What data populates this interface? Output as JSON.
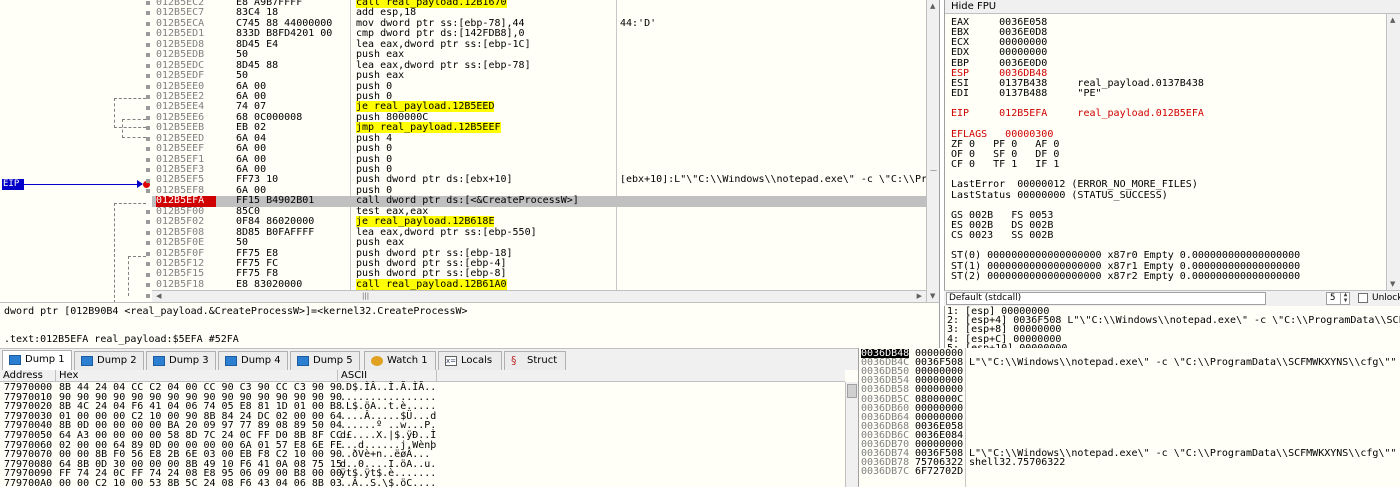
{
  "disasm": {
    "eip_label": "EIP",
    "rows": [
      {
        "addr": "012B5EC2",
        "bytes": "E8 A9B7FFFF",
        "ins": "call real_payload.12B1670",
        "cmt": "",
        "hl": "y"
      },
      {
        "addr": "012B5EC7",
        "bytes": "83C4 18",
        "ins": "add esp,18",
        "cmt": ""
      },
      {
        "addr": "012B5ECA",
        "bytes": "C745 88 44000000",
        "ins": "mov dword ptr ss:[ebp-78],44",
        "cmt": "44:'D'"
      },
      {
        "addr": "012B5ED1",
        "bytes": "833D B8FD4201 00",
        "ins": "cmp dword ptr ds:[142FDB8],0",
        "cmt": ""
      },
      {
        "addr": "012B5ED8",
        "bytes": "8D45 E4",
        "ins": "lea eax,dword ptr ss:[ebp-1C]",
        "cmt": ""
      },
      {
        "addr": "012B5EDB",
        "bytes": "50",
        "ins": "push eax",
        "cmt": ""
      },
      {
        "addr": "012B5EDC",
        "bytes": "8D45 88",
        "ins": "lea eax,dword ptr ss:[ebp-78]",
        "cmt": ""
      },
      {
        "addr": "012B5EDF",
        "bytes": "50",
        "ins": "push eax",
        "cmt": ""
      },
      {
        "addr": "012B5EE0",
        "bytes": "6A 00",
        "ins": "push 0",
        "cmt": ""
      },
      {
        "addr": "012B5EE2",
        "bytes": "6A 00",
        "ins": "push 0",
        "cmt": ""
      },
      {
        "addr": "012B5EE4",
        "bytes": "74 07",
        "ins": "je real_payload.12B5EED",
        "cmt": "",
        "hl": "y"
      },
      {
        "addr": "012B5EE6",
        "bytes": "68 0C000008",
        "ins": "push 800000C",
        "cmt": ""
      },
      {
        "addr": "012B5EEB",
        "bytes": "EB 02",
        "ins": "jmp real_payload.12B5EEF",
        "cmt": "",
        "hl": "y"
      },
      {
        "addr": "012B5EED",
        "bytes": "6A 04",
        "ins": "push 4",
        "cmt": ""
      },
      {
        "addr": "012B5EEF",
        "bytes": "6A 00",
        "ins": "push 0",
        "cmt": ""
      },
      {
        "addr": "012B5EF1",
        "bytes": "6A 00",
        "ins": "push 0",
        "cmt": ""
      },
      {
        "addr": "012B5EF3",
        "bytes": "6A 00",
        "ins": "push 0",
        "cmt": ""
      },
      {
        "addr": "012B5EF5",
        "bytes": "FF73 10",
        "ins": "push dword ptr ds:[ebx+10]",
        "cmt": "[ebx+10]:L\"\\\"C:\\\\Windows\\\\notepad.exe\\\" -c \\\"C:\\\\Prog"
      },
      {
        "addr": "012B5EF8",
        "bytes": "6A 00",
        "ins": "push 0",
        "cmt": ""
      },
      {
        "addr": "012B5EFA",
        "bytes": "FF15 B4902B01",
        "ins": "call dword ptr ds:[<&CreateProcessW>]",
        "cmt": "",
        "cur": true
      },
      {
        "addr": "012B5F00",
        "bytes": "85C0",
        "ins": "test eax,eax",
        "cmt": ""
      },
      {
        "addr": "012B5F02",
        "bytes": "0F84 86020000",
        "ins": "je real_payload.12B618E",
        "cmt": "",
        "hl": "y"
      },
      {
        "addr": "012B5F08",
        "bytes": "8D85 B0FAFFFF",
        "ins": "lea eax,dword ptr ss:[ebp-550]",
        "cmt": ""
      },
      {
        "addr": "012B5F0E",
        "bytes": "50",
        "ins": "push eax",
        "cmt": ""
      },
      {
        "addr": "012B5F0F",
        "bytes": "FF75 E8",
        "ins": "push dword ptr ss:[ebp-18]",
        "cmt": ""
      },
      {
        "addr": "012B5F12",
        "bytes": "FF75 FC",
        "ins": "push dword ptr ss:[ebp-4]",
        "cmt": ""
      },
      {
        "addr": "012B5F15",
        "bytes": "FF75 F8",
        "ins": "push dword ptr ss:[ebp-8]",
        "cmt": ""
      },
      {
        "addr": "012B5F18",
        "bytes": "E8 83020000",
        "ins": "call real_payload.12B61A0",
        "cmt": "",
        "hl": "y"
      },
      {
        "addr": "012B5F1D",
        "bytes": "83C4 10",
        "ins": "add esp,10",
        "cmt": ""
      },
      {
        "addr": "012B5F20",
        "bytes": "85C0",
        "ins": "test eax,eax",
        "cmt": ""
      }
    ]
  },
  "info": {
    "line1": "dword ptr [012B90B4 <real_payload.&CreateProcessW>]=<kernel32.CreateProcessW>",
    "line2": ".text:012B5EFA real_payload:$5EFA #52FA"
  },
  "regs": {
    "title": "Hide FPU",
    "lines": [
      {
        "t": "EAX     0036E058"
      },
      {
        "t": "EBX     0036E0D8"
      },
      {
        "t": "ECX     00000000"
      },
      {
        "t": "EDX     00000000"
      },
      {
        "t": "EBP     0036E0D0"
      },
      {
        "t": "ESP     0036DB48",
        "red": true
      },
      {
        "t": "ESI     0137B438     real_payload.0137B438"
      },
      {
        "t": "EDI     0137B488     \"PE\""
      },
      {
        "t": ""
      },
      {
        "t": "EIP     012B5EFA     real_payload.012B5EFA",
        "red": true
      },
      {
        "t": ""
      },
      {
        "t": "EFLAGS   00000300",
        "red": true
      },
      {
        "t": "ZF 0   PF 0   AF 0"
      },
      {
        "t": "OF 0   SF 0   DF 0"
      },
      {
        "t": "CF 0   TF 1   IF 1"
      },
      {
        "t": ""
      },
      {
        "t": "LastError  00000012 (ERROR_NO_MORE_FILES)"
      },
      {
        "t": "LastStatus 00000000 (STATUS_SUCCESS)"
      },
      {
        "t": ""
      },
      {
        "t": "GS 002B   FS 0053"
      },
      {
        "t": "ES 002B   DS 002B"
      },
      {
        "t": "CS 0023   SS 002B"
      },
      {
        "t": ""
      },
      {
        "t": "ST(0) 0000000000000000000 x87r0 Empty 0.000000000000000000"
      },
      {
        "t": "ST(1) 0000000000000000000 x87r1 Empty 0.000000000000000000"
      },
      {
        "t": "ST(2) 0000000000000000000 x87r2 Empty 0.000000000000000000"
      }
    ]
  },
  "callconv": {
    "convention": "Default (stdcall)",
    "arg_count": "5",
    "unlock_label": "Unlock"
  },
  "args": [
    "1: [esp] 00000000",
    "2: [esp+4] 0036F508 L\"\\\"C:\\\\Windows\\\\notepad.exe\\\" -c \\\"C:\\\\ProgramData\\\\SCFM",
    "3: [esp+8] 00000000",
    "4: [esp+C] 00000000",
    "5: [esp+10] 00000000"
  ],
  "tabs": [
    {
      "label": "Dump 1",
      "icon": "dump-icon",
      "active": true
    },
    {
      "label": "Dump 2",
      "icon": "dump-icon"
    },
    {
      "label": "Dump 3",
      "icon": "dump-icon"
    },
    {
      "label": "Dump 4",
      "icon": "dump-icon"
    },
    {
      "label": "Dump 5",
      "icon": "dump-icon"
    },
    {
      "label": "Watch 1",
      "icon": "watch-icon"
    },
    {
      "label": "Locals",
      "icon": "locals-icon"
    },
    {
      "label": "Struct",
      "icon": "struct-icon"
    }
  ],
  "dump": {
    "headers": {
      "address": "Address",
      "hex": "Hex",
      "ascii": "ASCII"
    },
    "rows": [
      {
        "addr": "77970000",
        "hex": "8B 44 24 04 CC C2 04 00 CC 90 C3 90 CC C3 90 90",
        "ascii": ".D$.ÌÂ..Ì.Ã.ÌÃ.."
      },
      {
        "addr": "77970010",
        "hex": "90 90 90 90 90 90 90 90 90 90 90 90 90 90 90 90",
        "ascii": "................"
      },
      {
        "addr": "77970020",
        "hex": "8B 4C 24 04 F6 41 04 06 74 05 E8 81 1D 01 00 B8",
        "ascii": ".L$.öA..t.è....."
      },
      {
        "addr": "77970030",
        "hex": "01 00 00 00 C2 10 00 90 8B 84 24 DC 02 00 00 64",
        "ascii": "....Â.....$Ü...d"
      },
      {
        "addr": "77970040",
        "hex": "8B 0D 00 00 00 00 BA 20 09 97 77 89 08 89 50 04",
        "ascii": "......º ..w...P."
      },
      {
        "addr": "77970050",
        "hex": "64 A3 00 00 00 00 58 8D 7C 24 0C FF D0 8B 8F CC",
        "ascii": "d£....X.|$.ÿÐ..Ì"
      },
      {
        "addr": "77970060",
        "hex": "02 00 00 64 89 0D 00 00 00 00 6A 01 57 E8 6E FE",
        "ascii": "...d......j.Wènþ"
      },
      {
        "addr": "77970070",
        "hex": "00 00 8B F0 56 E8 2B 6E 03 00 EB F8 C2 10 00 90",
        "ascii": "..ðVè+n..ëøÂ..."
      },
      {
        "addr": "77970080",
        "hex": "64 8B 0D 30 00 00 00 8B 49 10 F6 41 0A 08 75 15",
        "ascii": "d..0....I.öA..u."
      },
      {
        "addr": "77970090",
        "hex": "FF 74 24 0C FF 74 24 08 E8 95 06 09 00 B8 00 00",
        "ascii": "ÿt$.ÿt$.è......."
      },
      {
        "addr": "779700A0",
        "hex": "00 00 C2 10 00 53 8B 5C 24 08 F6 43 04 06 8B 03",
        "ascii": "..Â..S.\\$.öC...."
      }
    ]
  },
  "stack": [
    {
      "addr": "0036DB48",
      "val": "00000000",
      "cmt": "",
      "sel": true
    },
    {
      "addr": "0036DB4C",
      "val": "0036F508",
      "cmt": "L\"\\\"C:\\\\Windows\\\\notepad.exe\\\" -c \\\"C:\\\\ProgramData\\\\SCFMWKXYNS\\\\cfg\\\"\""
    },
    {
      "addr": "0036DB50",
      "val": "00000000",
      "cmt": ""
    },
    {
      "addr": "0036DB54",
      "val": "00000000",
      "cmt": ""
    },
    {
      "addr": "0036DB58",
      "val": "00000000",
      "cmt": ""
    },
    {
      "addr": "0036DB5C",
      "val": "0800000C",
      "cmt": ""
    },
    {
      "addr": "0036DB60",
      "val": "00000000",
      "cmt": ""
    },
    {
      "addr": "0036DB64",
      "val": "00000000",
      "cmt": ""
    },
    {
      "addr": "0036DB68",
      "val": "0036E058",
      "cmt": ""
    },
    {
      "addr": "0036DB6C",
      "val": "0036E084",
      "cmt": ""
    },
    {
      "addr": "0036DB70",
      "val": "00000000",
      "cmt": ""
    },
    {
      "addr": "0036DB74",
      "val": "0036F508",
      "cmt": "L\"\\\"C:\\\\Windows\\\\notepad.exe\\\" -c \\\"C:\\\\ProgramData\\\\SCFMWKXYNS\\\\cfg\\\"\""
    },
    {
      "addr": "0036DB78",
      "val": "75706322",
      "cmt": "shell32.75706322"
    },
    {
      "addr": "0036DB7C",
      "val": "6F72702D",
      "cmt": ""
    }
  ]
}
